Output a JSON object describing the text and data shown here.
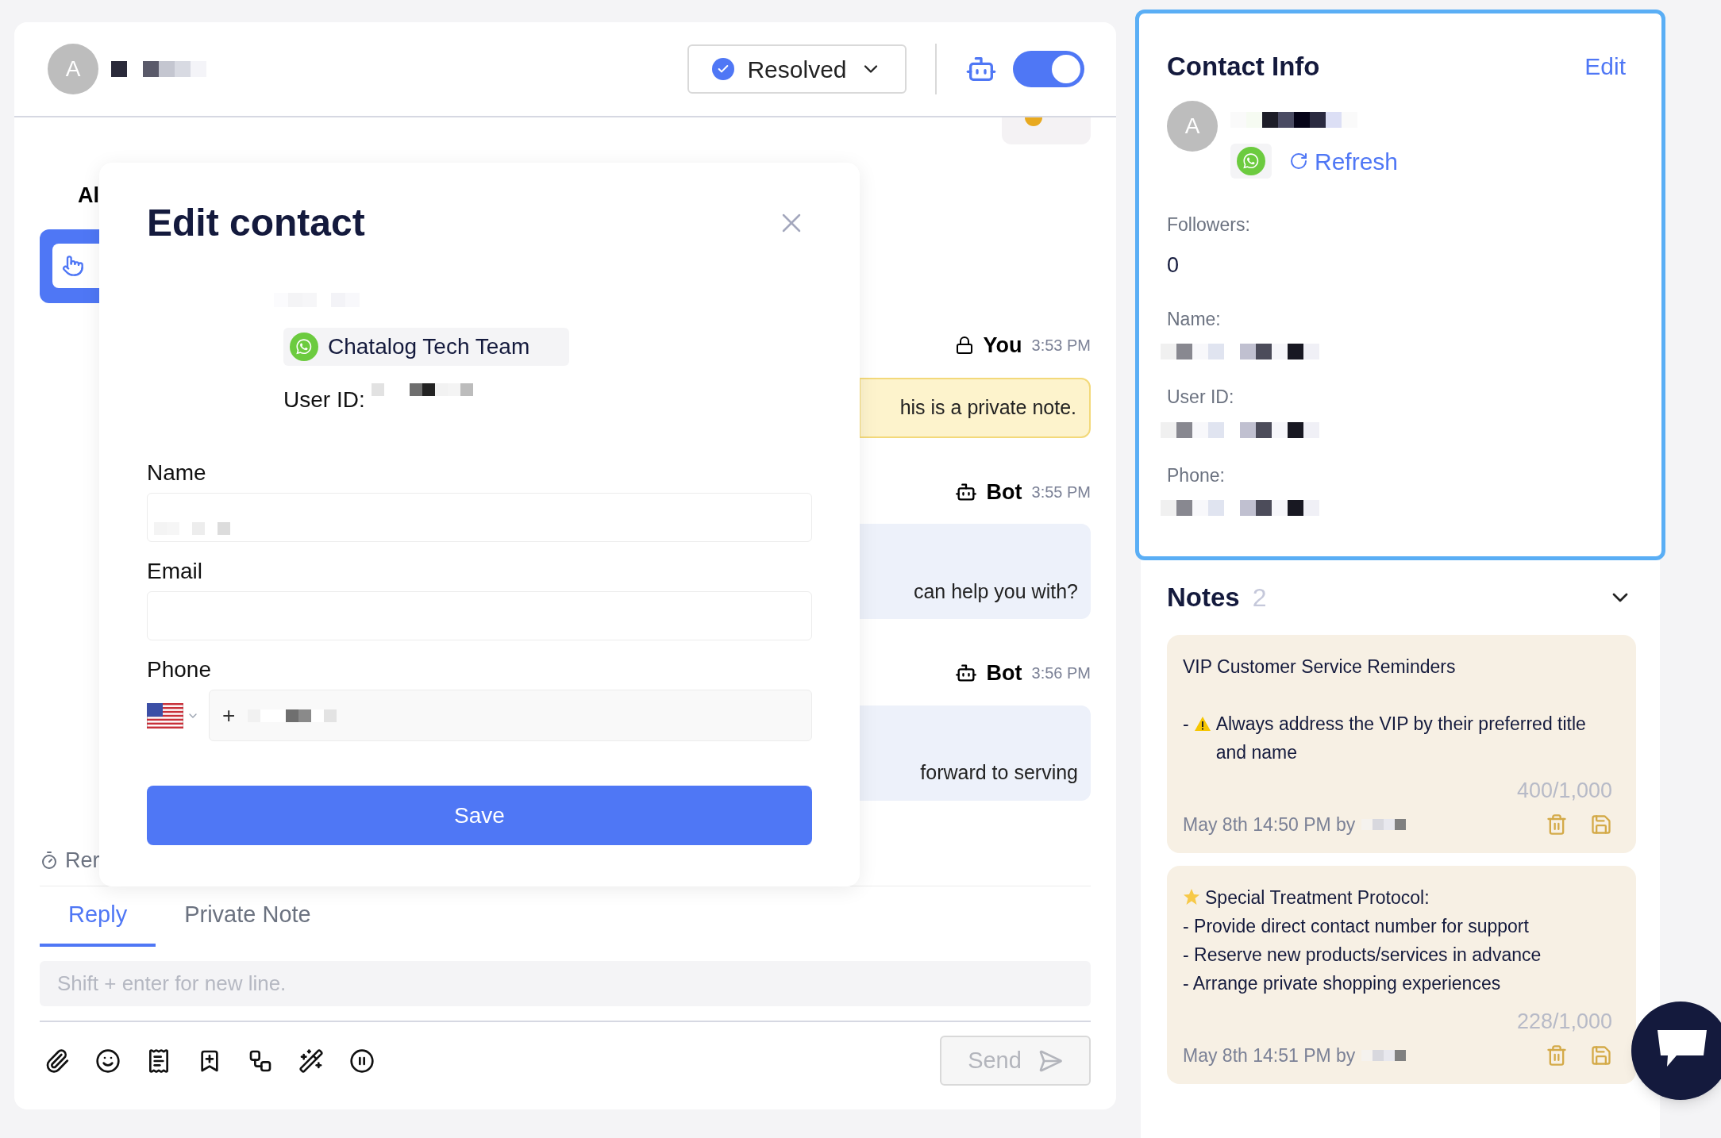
{
  "conversation_header": {
    "avatar_letter": "A",
    "status": "Resolved",
    "bot_enabled": true
  },
  "background": {
    "partial_heading": "Al",
    "reminders_partial": "Rer",
    "messages": [
      {
        "sender": "You",
        "kind": "private",
        "time": "3:53 PM",
        "text": "his is a private note."
      },
      {
        "sender": "Bot",
        "kind": "bot",
        "time": "3:55 PM",
        "text": "can help you with?"
      },
      {
        "sender": "Bot",
        "kind": "bot",
        "time": "3:56 PM",
        "text": "forward to serving"
      }
    ]
  },
  "composer": {
    "tabs": [
      {
        "label": "Reply",
        "selected": true
      },
      {
        "label": "Private Note",
        "selected": false
      }
    ],
    "placeholder": "Shift + enter for new line.",
    "send": "Send"
  },
  "edit_contact": {
    "title": "Edit contact",
    "channel": "Chatalog Tech Team",
    "user_id_label": "User ID:",
    "fields": [
      {
        "label": "Name",
        "kind": "text",
        "value_hidden": true
      },
      {
        "label": "Email",
        "kind": "text",
        "value_hidden": false
      },
      {
        "label": "Phone",
        "kind": "phone",
        "prefix": "+",
        "value_hidden": true
      }
    ],
    "save": "Save"
  },
  "contact_info": {
    "title": "Contact Info",
    "edit": "Edit",
    "avatar_letter": "A",
    "refresh": "Refresh",
    "fields": [
      {
        "label": "Followers:",
        "value": "0"
      },
      {
        "label": "Name:",
        "value_hidden": true
      },
      {
        "label": "User ID:",
        "value_hidden": true
      },
      {
        "label": "Phone:",
        "value_hidden": true
      }
    ]
  },
  "notes": {
    "title": "Notes",
    "count": "2",
    "expanded": true,
    "items": [
      {
        "paragraphs": [
          [
            {
              "kind": "plain",
              "text": "VIP Customer Service Reminders"
            }
          ],
          [
            {
              "kind": "warning",
              "prefix": "-",
              "text": "Always address the VIP by their preferred title and name"
            }
          ]
        ],
        "counter": "400/1,000",
        "meta": "May 8th 14:50 PM by"
      },
      {
        "paragraphs": [
          [
            {
              "kind": "star",
              "text": "Special Treatment Protocol:"
            },
            {
              "kind": "plain",
              "text": "- Provide direct contact number for support"
            },
            {
              "kind": "plain",
              "text": "- Reserve new products/services in advance"
            },
            {
              "kind": "plain",
              "text": "- Arrange private shopping experiences"
            }
          ]
        ],
        "counter": "228/1,000",
        "meta": "May 8th 14:51 PM by"
      }
    ]
  }
}
